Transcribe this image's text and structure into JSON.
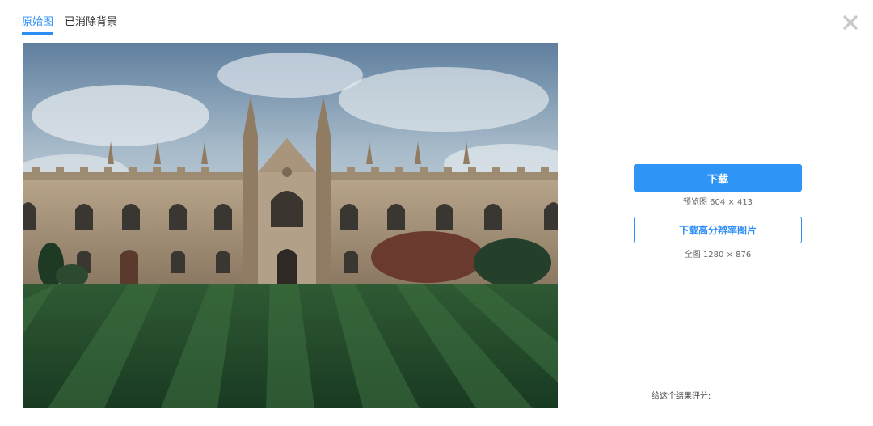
{
  "tabs": [
    {
      "label": "原始图",
      "active": true
    },
    {
      "label": "已消除背景",
      "active": false
    }
  ],
  "actions": {
    "download_label": "下载",
    "preview_size": "预览图 604 × 413",
    "download_hd_label": "下载高分辨率图片",
    "full_size": "全图 1280 × 876"
  },
  "rating_prompt": "给这个结果评分:",
  "colors": {
    "accent": "#2e95f7",
    "close_icon": "#c8c8c8"
  },
  "icons": {
    "close": "close-icon"
  }
}
